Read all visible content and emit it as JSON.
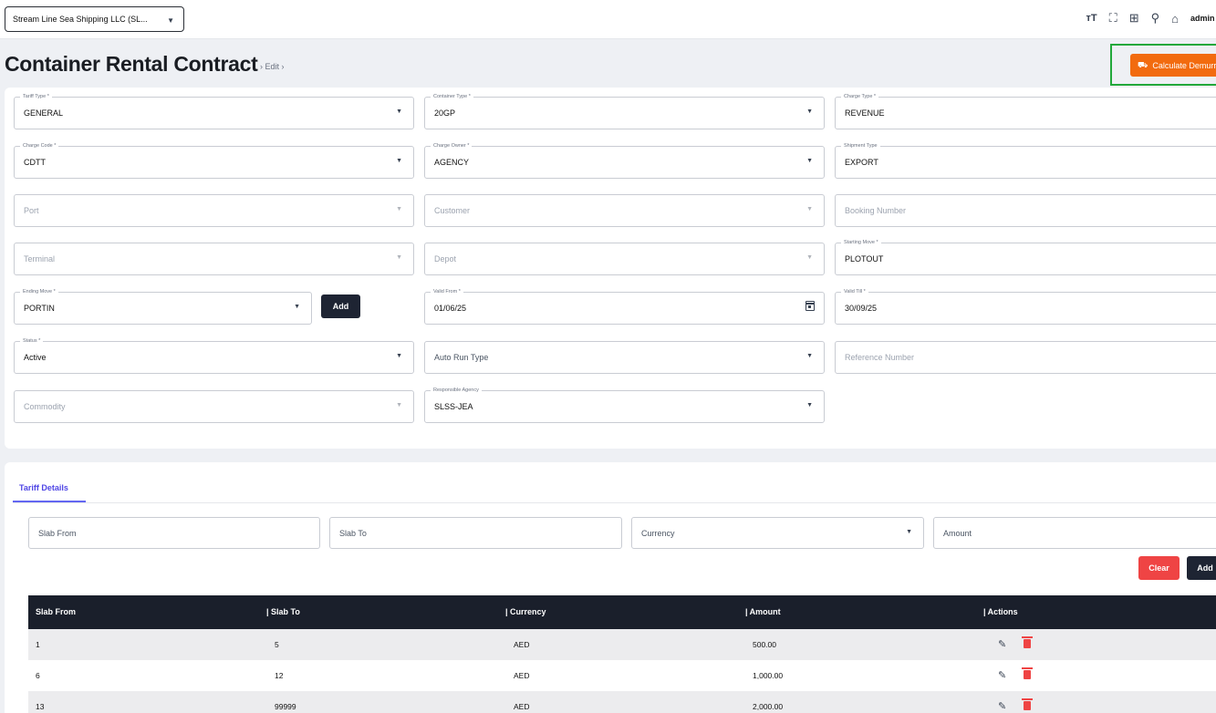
{
  "topbar": {
    "company": "Stream Line Sea Shipping LLC (SL...",
    "icons": [
      "text-size-icon",
      "fullscreen-icon",
      "apps-grid-icon",
      "search-icon",
      "home-icon"
    ],
    "user": "admin"
  },
  "header": {
    "title": "Container Rental Contract",
    "breadcrumb": "›  Edit  ›",
    "action_label": "Calculate Demurrage"
  },
  "form": {
    "tariff_type": {
      "label": "Tariff Type *",
      "value": "GENERAL"
    },
    "container_type": {
      "label": "Container Type *",
      "value": "20GP"
    },
    "charge_type": {
      "label": "Charge Type *",
      "value": "REVENUE"
    },
    "charge_code": {
      "label": "Charge Code *",
      "value": "CDTT"
    },
    "charge_owner": {
      "label": "Charge Owner *",
      "value": "AGENCY"
    },
    "shipment_type": {
      "label": "Shipment Type",
      "value": "EXPORT"
    },
    "port": {
      "placeholder": "Port"
    },
    "customer": {
      "placeholder": "Customer"
    },
    "booking_number": {
      "placeholder": "Booking Number"
    },
    "terminal": {
      "placeholder": "Terminal"
    },
    "depot": {
      "placeholder": "Depot"
    },
    "starting_move": {
      "label": "Starting Move *",
      "value": "PLOTOUT"
    },
    "ending_move": {
      "label": "Ending Move *",
      "value": "PORTIN"
    },
    "add_label": "Add",
    "valid_from": {
      "label": "Valid From *",
      "value": "01/06/25"
    },
    "valid_till": {
      "label": "Valid Till *",
      "value": "30/09/25"
    },
    "status": {
      "label": "Status *",
      "value": "Active"
    },
    "auto_run_type": {
      "placeholder": "Auto Run Type"
    },
    "reference_number": {
      "placeholder": "Reference Number"
    },
    "commodity": {
      "placeholder": "Commodity"
    },
    "responsible_agency": {
      "label": "Responsible Agency",
      "value": "SLSS-JEA"
    }
  },
  "tariff": {
    "tab_label": "Tariff Details",
    "slab_from_placeholder": "Slab From",
    "slab_to_placeholder": "Slab To",
    "currency_placeholder": "Currency",
    "amount_placeholder": "Amount",
    "clear_label": "Clear",
    "add_label": "Add",
    "columns": [
      "Slab From",
      "| Slab To",
      "| Currency",
      "| Amount",
      "| Actions"
    ],
    "rows": [
      {
        "slab_from": "1",
        "slab_to": "5",
        "currency": "AED",
        "amount": "500.00"
      },
      {
        "slab_from": "6",
        "slab_to": "12",
        "currency": "AED",
        "amount": "1,000.00"
      },
      {
        "slab_from": "13",
        "slab_to": "99999",
        "currency": "AED",
        "amount": "2,000.00"
      }
    ]
  },
  "colors": {
    "accent": "#f26b0f",
    "dark": "#1a1f2b",
    "danger": "#ef4444",
    "tab": "#4f46e5",
    "highlight": "#22a83a"
  }
}
